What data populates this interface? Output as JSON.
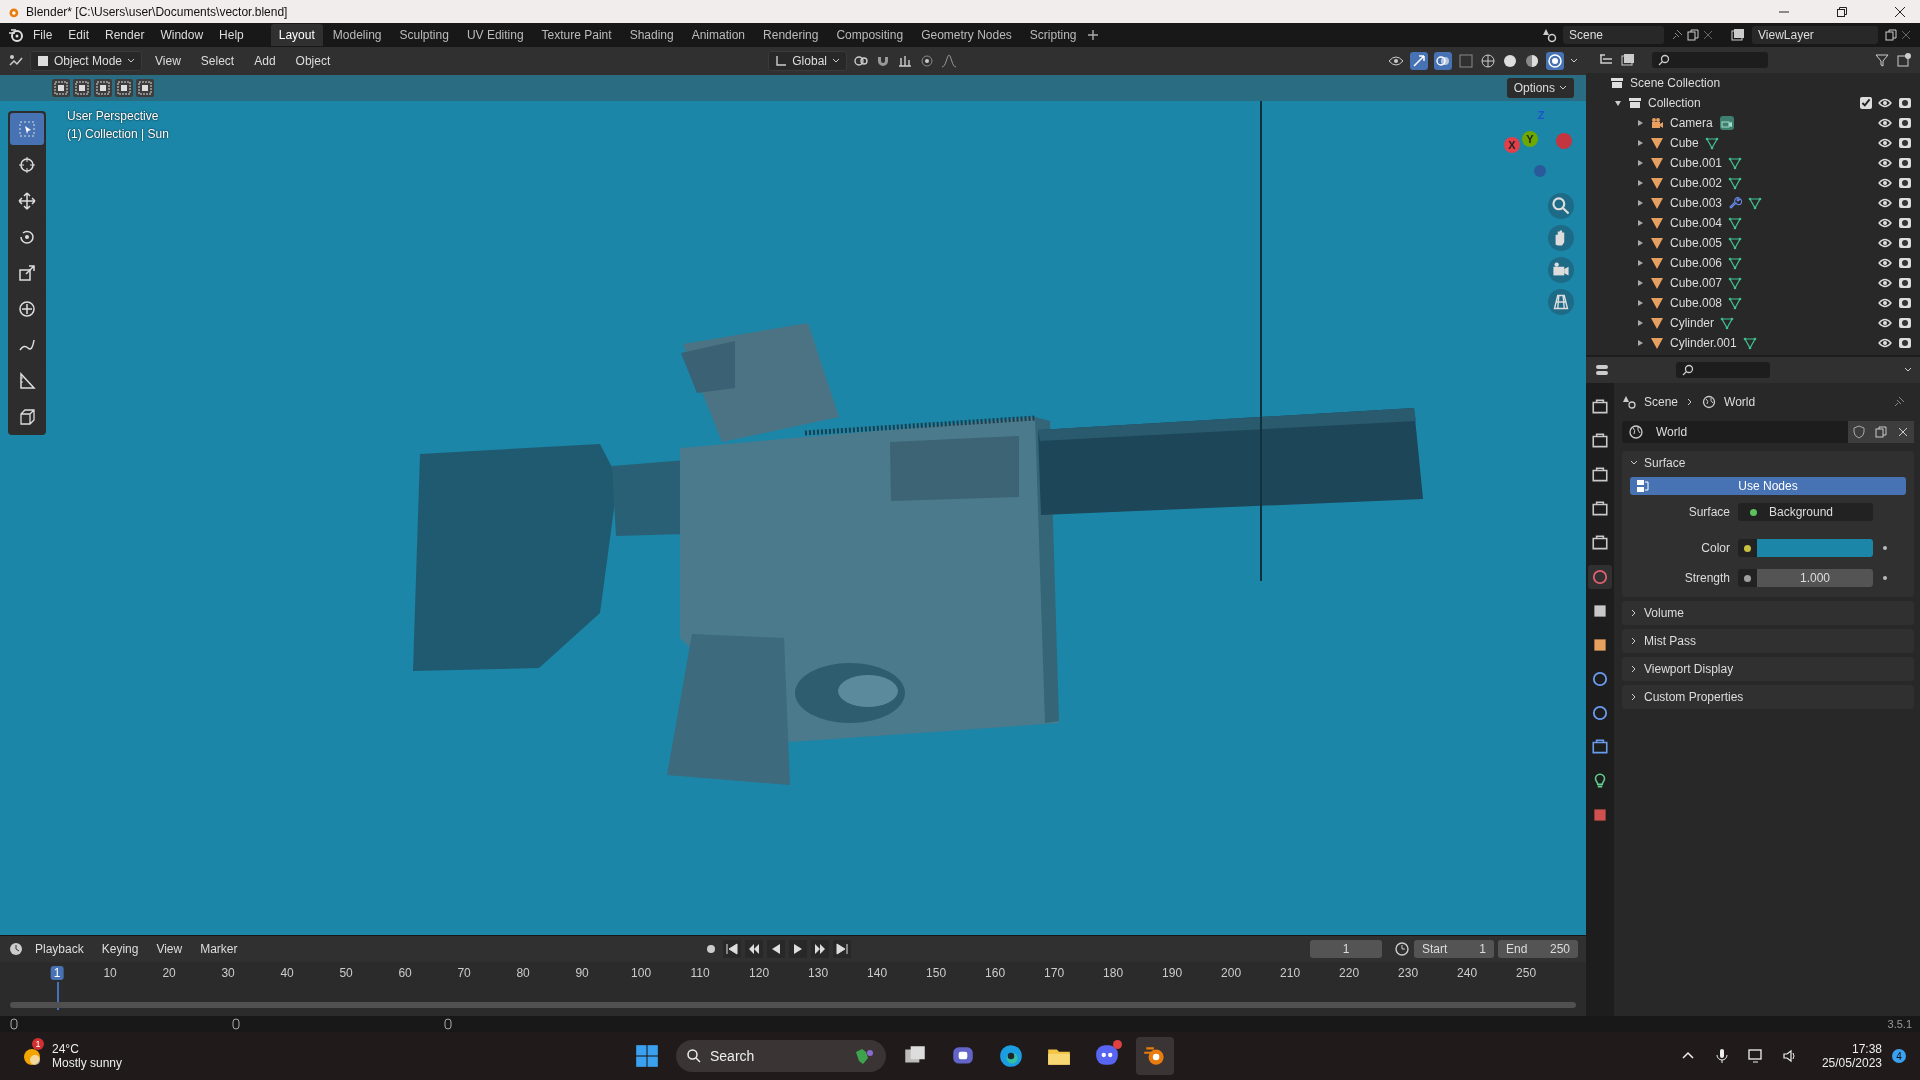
{
  "title_bar": {
    "title": "Blender* [C:\\Users\\user\\Documents\\vector.blend]"
  },
  "menu": [
    "File",
    "Edit",
    "Render",
    "Window",
    "Help"
  ],
  "workspaces": [
    {
      "label": "Layout",
      "selected": true
    },
    {
      "label": "Modeling",
      "selected": false
    },
    {
      "label": "Sculpting",
      "selected": false
    },
    {
      "label": "UV Editing",
      "selected": false
    },
    {
      "label": "Texture Paint",
      "selected": false
    },
    {
      "label": "Shading",
      "selected": false
    },
    {
      "label": "Animation",
      "selected": false
    },
    {
      "label": "Rendering",
      "selected": false
    },
    {
      "label": "Compositing",
      "selected": false
    },
    {
      "label": "Geometry Nodes",
      "selected": false
    },
    {
      "label": "Scripting",
      "selected": false
    }
  ],
  "scene": "Scene",
  "view_layer": "ViewLayer",
  "viewport_header": {
    "mode": "Object Mode",
    "menus": [
      "View",
      "Select",
      "Add",
      "Object"
    ],
    "orientation": "Global",
    "options": "Options"
  },
  "viewport": {
    "lines": [
      "User Perspective",
      "(1) Collection | Sun"
    ],
    "gizmo": {
      "z": "Z",
      "y": "Y",
      "x": "X"
    }
  },
  "tools": [
    {
      "kind": "select",
      "selected": true
    },
    {
      "kind": "cursor",
      "selected": false
    },
    {
      "kind": "move",
      "selected": false
    },
    {
      "kind": "rotate",
      "selected": false
    },
    {
      "kind": "scale",
      "selected": false
    },
    {
      "kind": "transform",
      "selected": false
    },
    {
      "kind": "annotate",
      "selected": false
    },
    {
      "kind": "measure",
      "selected": false
    },
    {
      "kind": "add-cube",
      "selected": false
    }
  ],
  "outliner": {
    "root": "Scene Collection",
    "collection": {
      "label": "Collection",
      "expanded": true,
      "checked": true,
      "children": [
        {
          "name": "Camera",
          "kind": "camera",
          "modifier": false
        },
        {
          "name": "Cube",
          "kind": "mesh",
          "modifier": false
        },
        {
          "name": "Cube.001",
          "kind": "mesh",
          "modifier": false
        },
        {
          "name": "Cube.002",
          "kind": "mesh",
          "modifier": false
        },
        {
          "name": "Cube.003",
          "kind": "mesh",
          "modifier": true
        },
        {
          "name": "Cube.004",
          "kind": "mesh",
          "modifier": false
        },
        {
          "name": "Cube.005",
          "kind": "mesh",
          "modifier": false
        },
        {
          "name": "Cube.006",
          "kind": "mesh",
          "modifier": false
        },
        {
          "name": "Cube.007",
          "kind": "mesh",
          "modifier": false
        },
        {
          "name": "Cube.008",
          "kind": "mesh",
          "modifier": false
        },
        {
          "name": "Cylinder",
          "kind": "mesh",
          "modifier": false
        },
        {
          "name": "Cylinder.001",
          "kind": "mesh",
          "modifier": false
        }
      ]
    }
  },
  "properties": {
    "tabs": [
      {
        "kind": "tool",
        "selected": false
      },
      {
        "kind": "render",
        "selected": false
      },
      {
        "kind": "output",
        "selected": false
      },
      {
        "kind": "view-layer",
        "selected": false
      },
      {
        "kind": "scene",
        "selected": false
      },
      {
        "kind": "world",
        "selected": true
      },
      {
        "kind": "collection",
        "selected": false
      },
      {
        "kind": "object",
        "selected": false
      },
      {
        "kind": "modifier",
        "selected": false
      },
      {
        "kind": "physics",
        "selected": false
      },
      {
        "kind": "constraint",
        "selected": false
      },
      {
        "kind": "data",
        "selected": false
      },
      {
        "kind": "texture",
        "selected": false
      }
    ],
    "breadcrumb": [
      "Scene",
      "World"
    ],
    "datablock": "World",
    "use_nodes": "Use Nodes",
    "fields": [
      {
        "label": "Surface",
        "kind": "shader",
        "value": "Background"
      },
      {
        "label": "Color",
        "kind": "color",
        "color": "#1b86a8"
      },
      {
        "label": "Strength",
        "kind": "number",
        "value": "1.000"
      }
    ],
    "panels": [
      {
        "title": "Surface",
        "expanded": true
      },
      {
        "title": "Volume",
        "expanded": false
      },
      {
        "title": "Mist Pass",
        "expanded": false
      },
      {
        "title": "Viewport Display",
        "expanded": false
      },
      {
        "title": "Custom Properties",
        "expanded": false
      }
    ]
  },
  "timeline": {
    "menus": [
      "Playback",
      "Keying",
      "View",
      "Marker"
    ],
    "current_frame": "1",
    "start_label": "Start",
    "start": "1",
    "end_label": "End",
    "end": "250",
    "ticks": [
      {
        "label": "1",
        "selected": true
      },
      {
        "label": "10",
        "selected": false
      },
      {
        "label": "20",
        "selected": false
      },
      {
        "label": "30",
        "selected": false
      },
      {
        "label": "40",
        "selected": false
      },
      {
        "label": "50",
        "selected": false
      },
      {
        "label": "60",
        "selected": false
      },
      {
        "label": "70",
        "selected": false
      },
      {
        "label": "80",
        "selected": false
      },
      {
        "label": "90",
        "selected": false
      },
      {
        "label": "100",
        "selected": false
      },
      {
        "label": "110",
        "selected": false
      },
      {
        "label": "120",
        "selected": false
      },
      {
        "label": "130",
        "selected": false
      },
      {
        "label": "140",
        "selected": false
      },
      {
        "label": "150",
        "selected": false
      },
      {
        "label": "160",
        "selected": false
      },
      {
        "label": "170",
        "selected": false
      },
      {
        "label": "180",
        "selected": false
      },
      {
        "label": "190",
        "selected": false
      },
      {
        "label": "200",
        "selected": false
      },
      {
        "label": "210",
        "selected": false
      },
      {
        "label": "220",
        "selected": false
      },
      {
        "label": "230",
        "selected": false
      },
      {
        "label": "240",
        "selected": false
      },
      {
        "label": "250",
        "selected": false
      }
    ]
  },
  "status_bar": {
    "version": "3.5.1"
  },
  "taskbar": {
    "weather_badge": "1",
    "temperature": "24°C",
    "condition": "Mostly sunny",
    "search": "Search",
    "discord_badge": true,
    "time": "17:38",
    "date": "25/05/2023",
    "notifications": "4"
  }
}
